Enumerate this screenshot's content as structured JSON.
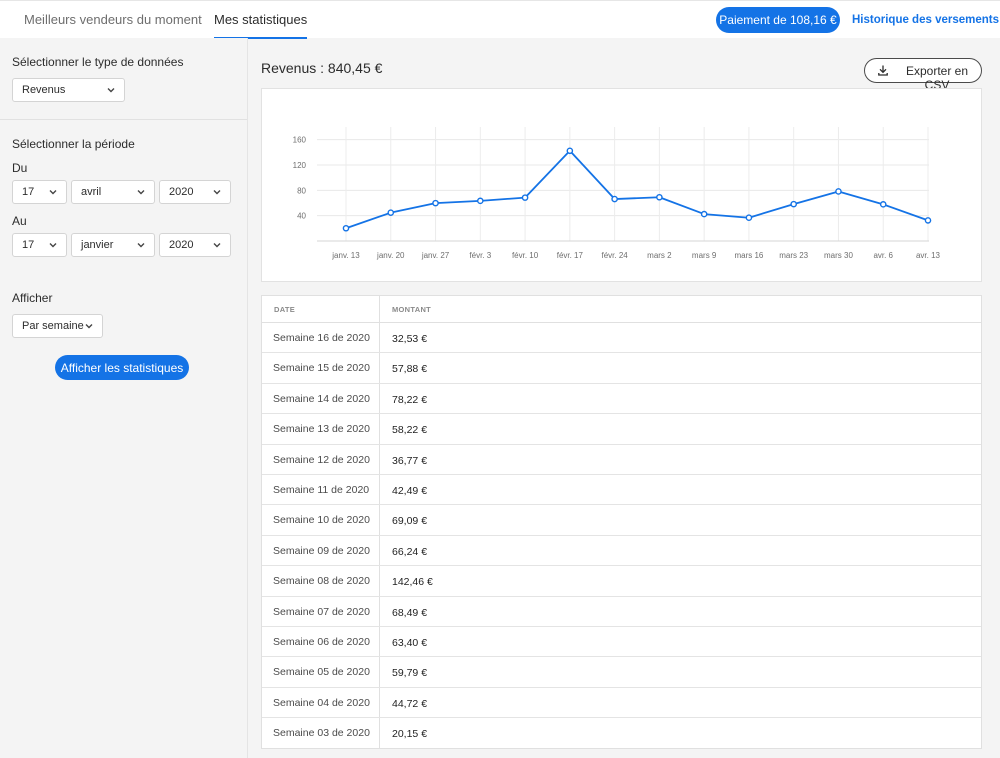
{
  "tabs": [
    {
      "label": "Meilleurs vendeurs du moment",
      "active": false
    },
    {
      "label": "Mes statistiques",
      "active": true
    }
  ],
  "header": {
    "payment_button": "Paiement de 108,16 €",
    "history_link": "Historique des versements"
  },
  "sidebar": {
    "data_type_label": "Sélectionner le type de données",
    "data_type_value": "Revenus",
    "period_label": "Sélectionner la période",
    "from_label": "Du",
    "from": {
      "day": "17",
      "month": "avril",
      "year": "2020"
    },
    "to_label": "Au",
    "to": {
      "day": "17",
      "month": "janvier",
      "year": "2020"
    },
    "display_label": "Afficher",
    "display_value": "Par semaine",
    "show_button": "Afficher les statistiques"
  },
  "main": {
    "revenue_title": "Revenus : 840,45 €",
    "export_button": "Exporter en CSV"
  },
  "chart_data": {
    "type": "line",
    "x": [
      "janv. 13",
      "janv. 20",
      "janv. 27",
      "févr. 3",
      "févr. 10",
      "févr. 17",
      "févr. 24",
      "mars 2",
      "mars 9",
      "mars 16",
      "mars 23",
      "mars 30",
      "avr. 6",
      "avr. 13"
    ],
    "series": [
      {
        "values": [
          20.15,
          44.72,
          59.79,
          63.4,
          68.49,
          142.46,
          66.24,
          69.09,
          42.49,
          36.77,
          58.22,
          78.22,
          57.88,
          32.53
        ]
      }
    ],
    "yticks": [
      "40",
      "80",
      "120",
      "160"
    ],
    "ylim": [
      0,
      180
    ],
    "grid": true,
    "color": "#1473e6"
  },
  "table": {
    "headers": [
      "DATE",
      "MONTANT"
    ],
    "rows": [
      {
        "date": "Semaine 16 de 2020",
        "amount": "32,53 €"
      },
      {
        "date": "Semaine 15 de 2020",
        "amount": "57,88 €"
      },
      {
        "date": "Semaine 14 de 2020",
        "amount": "78,22 €"
      },
      {
        "date": "Semaine 13 de 2020",
        "amount": "58,22 €"
      },
      {
        "date": "Semaine 12 de 2020",
        "amount": "36,77 €"
      },
      {
        "date": "Semaine 11 de 2020",
        "amount": "42,49 €"
      },
      {
        "date": "Semaine 10 de 2020",
        "amount": "69,09 €"
      },
      {
        "date": "Semaine 09 de 2020",
        "amount": "66,24 €"
      },
      {
        "date": "Semaine 08 de 2020",
        "amount": "142,46 €"
      },
      {
        "date": "Semaine 07 de 2020",
        "amount": "68,49 €"
      },
      {
        "date": "Semaine 06 de 2020",
        "amount": "63,40 €"
      },
      {
        "date": "Semaine 05 de 2020",
        "amount": "59,79 €"
      },
      {
        "date": "Semaine 04 de 2020",
        "amount": "44,72 €"
      },
      {
        "date": "Semaine 03 de 2020",
        "amount": "20,15 €"
      }
    ]
  }
}
